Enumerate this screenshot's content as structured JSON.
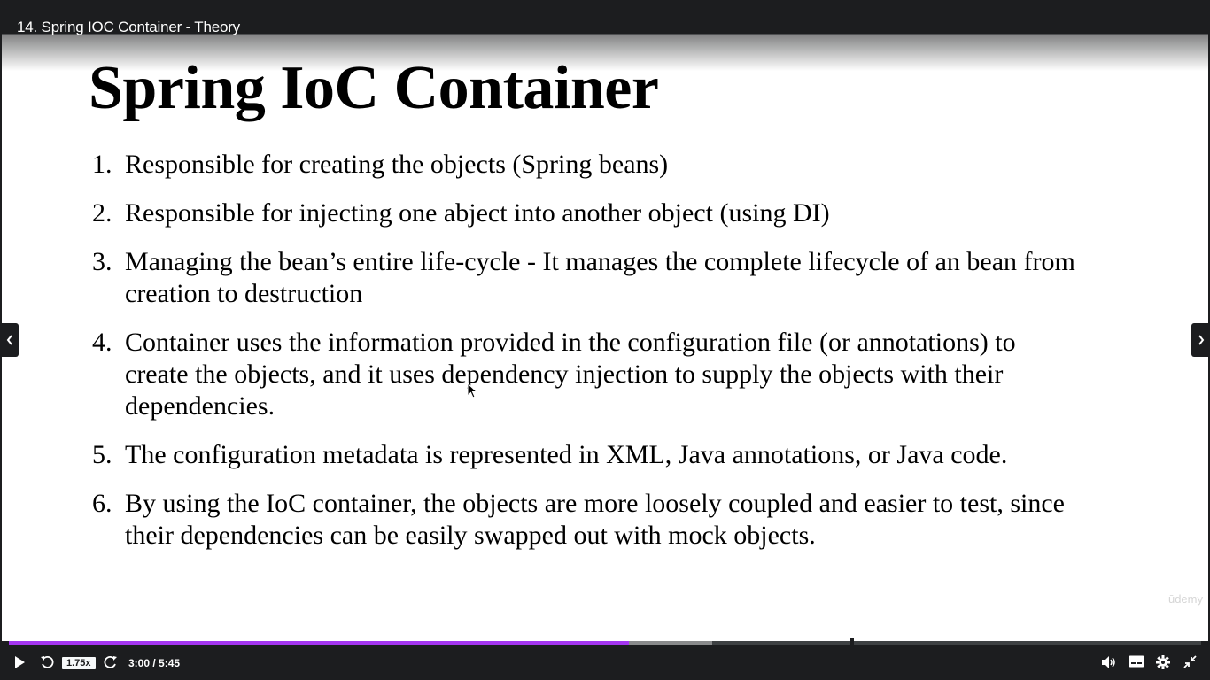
{
  "player": {
    "video_title": "14. Spring IOC Container - Theory",
    "speed": "1.75x",
    "time": "3:00 / 5:45",
    "progress_fraction": 0.52,
    "buffered_fraction": 0.59,
    "accent_color": "#a435f0",
    "watermark": "ūdemy"
  },
  "slide": {
    "heading": "Spring IoC Container",
    "points": [
      {
        "num": "1.",
        "text": "Responsible for creating the objects (Spring beans)"
      },
      {
        "num": "2.",
        "text": "Responsible for injecting one abject into another object (using DI)"
      },
      {
        "num": "3.",
        "text": "Managing the bean’s entire life-cycle - It manages the complete lifecycle of an bean from creation to destruction"
      },
      {
        "num": "4.",
        "text": "Container uses the information provided in the configuration file (or annotations) to create the objects, and it uses dependency injection to supply the objects with their dependencies."
      },
      {
        "num": "5.",
        "text": "The configuration metadata is represented in XML, Java annotations, or Java code."
      },
      {
        "num": "6.",
        "text": "By using the IoC container, the objects are more loosely coupled and easier to test, since their dependencies can be easily swapped out with mock objects."
      }
    ]
  },
  "icons": {
    "prev": "chevron-left-icon",
    "next": "chevron-right-icon",
    "play": "play-icon",
    "rewind": "rewind-5-icon",
    "forward": "forward-5-icon",
    "volume": "volume-icon",
    "captions": "captions-icon",
    "settings": "gear-icon",
    "exit_fullscreen": "exit-fullscreen-icon"
  }
}
